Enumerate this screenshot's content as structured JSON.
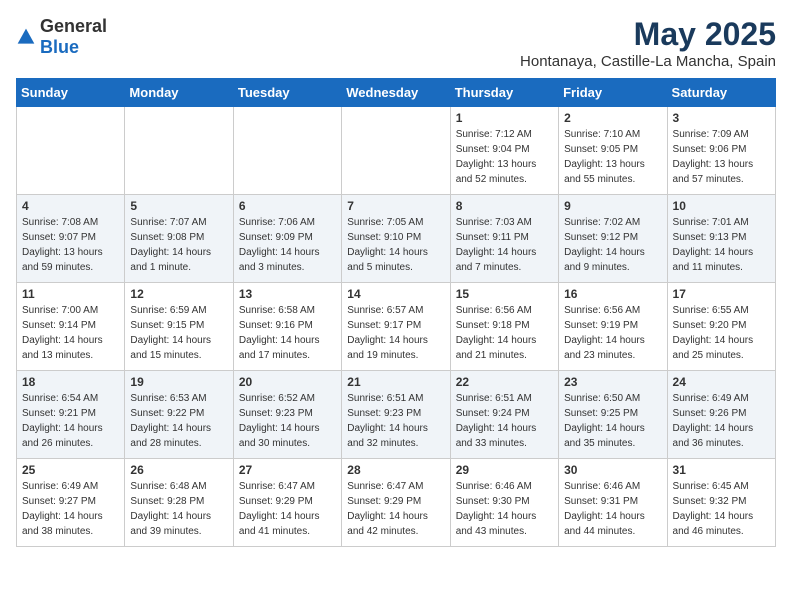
{
  "header": {
    "logo_general": "General",
    "logo_blue": "Blue",
    "title": "May 2025",
    "subtitle": "Hontanaya, Castille-La Mancha, Spain"
  },
  "calendar": {
    "weekdays": [
      "Sunday",
      "Monday",
      "Tuesday",
      "Wednesday",
      "Thursday",
      "Friday",
      "Saturday"
    ],
    "weeks": [
      [
        {
          "day": "",
          "info": ""
        },
        {
          "day": "",
          "info": ""
        },
        {
          "day": "",
          "info": ""
        },
        {
          "day": "",
          "info": ""
        },
        {
          "day": "1",
          "info": "Sunrise: 7:12 AM\nSunset: 9:04 PM\nDaylight: 13 hours\nand 52 minutes."
        },
        {
          "day": "2",
          "info": "Sunrise: 7:10 AM\nSunset: 9:05 PM\nDaylight: 13 hours\nand 55 minutes."
        },
        {
          "day": "3",
          "info": "Sunrise: 7:09 AM\nSunset: 9:06 PM\nDaylight: 13 hours\nand 57 minutes."
        }
      ],
      [
        {
          "day": "4",
          "info": "Sunrise: 7:08 AM\nSunset: 9:07 PM\nDaylight: 13 hours\nand 59 minutes."
        },
        {
          "day": "5",
          "info": "Sunrise: 7:07 AM\nSunset: 9:08 PM\nDaylight: 14 hours\nand 1 minute."
        },
        {
          "day": "6",
          "info": "Sunrise: 7:06 AM\nSunset: 9:09 PM\nDaylight: 14 hours\nand 3 minutes."
        },
        {
          "day": "7",
          "info": "Sunrise: 7:05 AM\nSunset: 9:10 PM\nDaylight: 14 hours\nand 5 minutes."
        },
        {
          "day": "8",
          "info": "Sunrise: 7:03 AM\nSunset: 9:11 PM\nDaylight: 14 hours\nand 7 minutes."
        },
        {
          "day": "9",
          "info": "Sunrise: 7:02 AM\nSunset: 9:12 PM\nDaylight: 14 hours\nand 9 minutes."
        },
        {
          "day": "10",
          "info": "Sunrise: 7:01 AM\nSunset: 9:13 PM\nDaylight: 14 hours\nand 11 minutes."
        }
      ],
      [
        {
          "day": "11",
          "info": "Sunrise: 7:00 AM\nSunset: 9:14 PM\nDaylight: 14 hours\nand 13 minutes."
        },
        {
          "day": "12",
          "info": "Sunrise: 6:59 AM\nSunset: 9:15 PM\nDaylight: 14 hours\nand 15 minutes."
        },
        {
          "day": "13",
          "info": "Sunrise: 6:58 AM\nSunset: 9:16 PM\nDaylight: 14 hours\nand 17 minutes."
        },
        {
          "day": "14",
          "info": "Sunrise: 6:57 AM\nSunset: 9:17 PM\nDaylight: 14 hours\nand 19 minutes."
        },
        {
          "day": "15",
          "info": "Sunrise: 6:56 AM\nSunset: 9:18 PM\nDaylight: 14 hours\nand 21 minutes."
        },
        {
          "day": "16",
          "info": "Sunrise: 6:56 AM\nSunset: 9:19 PM\nDaylight: 14 hours\nand 23 minutes."
        },
        {
          "day": "17",
          "info": "Sunrise: 6:55 AM\nSunset: 9:20 PM\nDaylight: 14 hours\nand 25 minutes."
        }
      ],
      [
        {
          "day": "18",
          "info": "Sunrise: 6:54 AM\nSunset: 9:21 PM\nDaylight: 14 hours\nand 26 minutes."
        },
        {
          "day": "19",
          "info": "Sunrise: 6:53 AM\nSunset: 9:22 PM\nDaylight: 14 hours\nand 28 minutes."
        },
        {
          "day": "20",
          "info": "Sunrise: 6:52 AM\nSunset: 9:23 PM\nDaylight: 14 hours\nand 30 minutes."
        },
        {
          "day": "21",
          "info": "Sunrise: 6:51 AM\nSunset: 9:23 PM\nDaylight: 14 hours\nand 32 minutes."
        },
        {
          "day": "22",
          "info": "Sunrise: 6:51 AM\nSunset: 9:24 PM\nDaylight: 14 hours\nand 33 minutes."
        },
        {
          "day": "23",
          "info": "Sunrise: 6:50 AM\nSunset: 9:25 PM\nDaylight: 14 hours\nand 35 minutes."
        },
        {
          "day": "24",
          "info": "Sunrise: 6:49 AM\nSunset: 9:26 PM\nDaylight: 14 hours\nand 36 minutes."
        }
      ],
      [
        {
          "day": "25",
          "info": "Sunrise: 6:49 AM\nSunset: 9:27 PM\nDaylight: 14 hours\nand 38 minutes."
        },
        {
          "day": "26",
          "info": "Sunrise: 6:48 AM\nSunset: 9:28 PM\nDaylight: 14 hours\nand 39 minutes."
        },
        {
          "day": "27",
          "info": "Sunrise: 6:47 AM\nSunset: 9:29 PM\nDaylight: 14 hours\nand 41 minutes."
        },
        {
          "day": "28",
          "info": "Sunrise: 6:47 AM\nSunset: 9:29 PM\nDaylight: 14 hours\nand 42 minutes."
        },
        {
          "day": "29",
          "info": "Sunrise: 6:46 AM\nSunset: 9:30 PM\nDaylight: 14 hours\nand 43 minutes."
        },
        {
          "day": "30",
          "info": "Sunrise: 6:46 AM\nSunset: 9:31 PM\nDaylight: 14 hours\nand 44 minutes."
        },
        {
          "day": "31",
          "info": "Sunrise: 6:45 AM\nSunset: 9:32 PM\nDaylight: 14 hours\nand 46 minutes."
        }
      ]
    ]
  }
}
